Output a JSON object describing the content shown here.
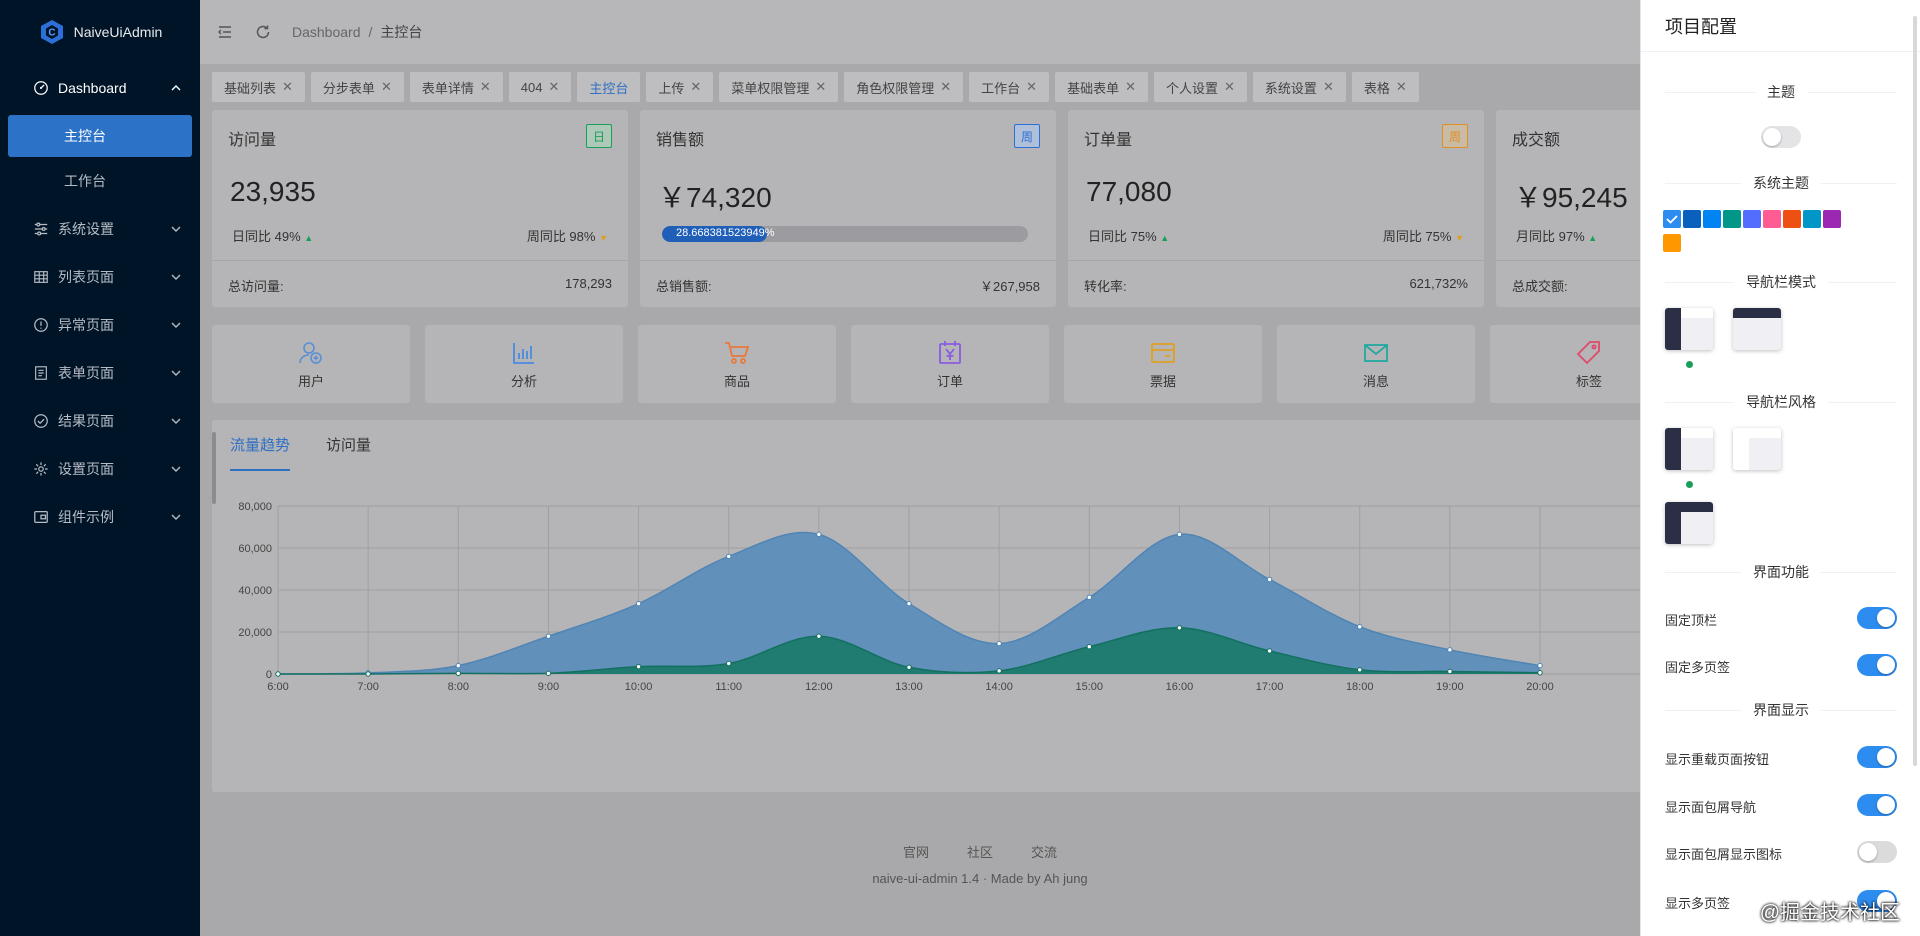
{
  "app": {
    "name": "NaiveUiAdmin"
  },
  "sidebar": {
    "items": [
      {
        "label": "Dashboard",
        "icon": "dashboard-icon",
        "open": true,
        "children": [
          {
            "label": "主控台",
            "active": true
          },
          {
            "label": "工作台",
            "active": false
          }
        ]
      },
      {
        "label": "系统设置",
        "icon": "sliders-icon"
      },
      {
        "label": "列表页面",
        "icon": "table-icon"
      },
      {
        "label": "异常页面",
        "icon": "alert-circle-icon"
      },
      {
        "label": "表单页面",
        "icon": "form-icon"
      },
      {
        "label": "结果页面",
        "icon": "check-circle-icon"
      },
      {
        "label": "设置页面",
        "icon": "gear-icon"
      },
      {
        "label": "组件示例",
        "icon": "wallet-icon"
      }
    ]
  },
  "topbar": {
    "breadcrumb": [
      "Dashboard",
      "主控台"
    ]
  },
  "tabs": [
    {
      "label": "基础列表"
    },
    {
      "label": "分步表单"
    },
    {
      "label": "表单详情"
    },
    {
      "label": "404"
    },
    {
      "label": "主控台",
      "active": true
    },
    {
      "label": "上传"
    },
    {
      "label": "菜单权限管理"
    },
    {
      "label": "角色权限管理"
    },
    {
      "label": "工作台"
    },
    {
      "label": "基础表单"
    },
    {
      "label": "个人设置"
    },
    {
      "label": "系统设置"
    },
    {
      "label": "表格"
    }
  ],
  "stats": [
    {
      "title": "访问量",
      "tag": "日",
      "tag_color": "#18a058",
      "value": "23,935",
      "left": "日同比 49%",
      "left_trend": "up",
      "right": "周同比 98%",
      "right_trend": "down",
      "foot_label": "总访问量:",
      "foot_value": "178,293"
    },
    {
      "title": "销售额",
      "tag": "周",
      "tag_color": "#2d8cf0",
      "value": "￥74,320",
      "progress": 0.2866838152394,
      "progress_text": "28.668381523949%",
      "foot_label": "总销售额:",
      "foot_value": "￥267,958"
    },
    {
      "title": "订单量",
      "tag": "周",
      "tag_color": "#f0a020",
      "value": "77,080",
      "left": "日同比 75%",
      "left_trend": "up",
      "right": "周同比 75%",
      "right_trend": "down",
      "foot_label": "转化率:",
      "foot_value": "621,732%"
    },
    {
      "title": "成交额",
      "tag": "",
      "value": "￥95,245",
      "left": "月同比 97%",
      "left_trend": "up",
      "foot_label": "总成交额:",
      "foot_value": ""
    }
  ],
  "quick_entries": [
    {
      "label": "用户",
      "icon": "user-add-icon",
      "color": "#5a8fd6"
    },
    {
      "label": "分析",
      "icon": "bar-chart-icon",
      "color": "#4a8be0"
    },
    {
      "label": "商品",
      "icon": "cart-icon",
      "color": "#e8793a"
    },
    {
      "label": "订单",
      "icon": "calendar-order-icon",
      "color": "#8a5be0"
    },
    {
      "label": "票据",
      "icon": "card-icon",
      "color": "#e0a020"
    },
    {
      "label": "消息",
      "icon": "mail-icon",
      "color": "#22a8a0"
    },
    {
      "label": "标签",
      "icon": "tag-icon",
      "color": "#e04a6a"
    }
  ],
  "chart_tabs": [
    {
      "label": "流量趋势",
      "active": true
    },
    {
      "label": "访问量",
      "active": false
    }
  ],
  "chart_data": {
    "type": "area",
    "x": [
      "6:00",
      "7:00",
      "8:00",
      "9:00",
      "10:00",
      "11:00",
      "12:00",
      "13:00",
      "14:00",
      "15:00",
      "16:00",
      "17:00",
      "18:00",
      "19:00",
      "20:00"
    ],
    "ylim": [
      0,
      80000
    ],
    "yticks": [
      "0",
      "20,000",
      "40,000",
      "60,000",
      "80,000"
    ],
    "series": [
      {
        "values": [
          0,
          500,
          4000,
          18000,
          33500,
          56000,
          66500,
          33500,
          14500,
          36500,
          66500,
          45000,
          22500,
          11500,
          4000
        ],
        "color": "#5d8fbb"
      },
      {
        "values": [
          0,
          0,
          300,
          300,
          3500,
          5000,
          18000,
          3200,
          1500,
          13000,
          22000,
          11000,
          2000,
          1200,
          600
        ],
        "color": "#1c7a6c"
      }
    ],
    "grid": true
  },
  "footer": {
    "links": [
      "官网",
      "社区",
      "交流"
    ],
    "copyright": "naive-ui-admin 1.4 · Made by Ah jung"
  },
  "drawer": {
    "title": "项目配置",
    "theme_section": "主题",
    "system_theme_section": "系统主题",
    "colors": [
      "#2d8cf0",
      "#0960bd",
      "#0084f4",
      "#009688",
      "#536dfe",
      "#ff5c93",
      "#ee4f12",
      "#0096c7",
      "#9c27b0",
      "#ff9800"
    ],
    "nav_mode_section": "导航栏模式",
    "nav_style_section": "导航栏风格",
    "features_section": "界面功能",
    "display_section": "界面显示",
    "options": [
      {
        "label": "固定顶栏",
        "on": true
      },
      {
        "label": "固定多页签",
        "on": true
      },
      {
        "label": "显示重载页面按钮",
        "on": true
      },
      {
        "label": "显示面包屑导航",
        "on": true
      },
      {
        "label": "显示面包屑显示图标",
        "on": false
      },
      {
        "label": "显示多页签",
        "on": true
      }
    ]
  },
  "watermark": "@掘金技术社区"
}
